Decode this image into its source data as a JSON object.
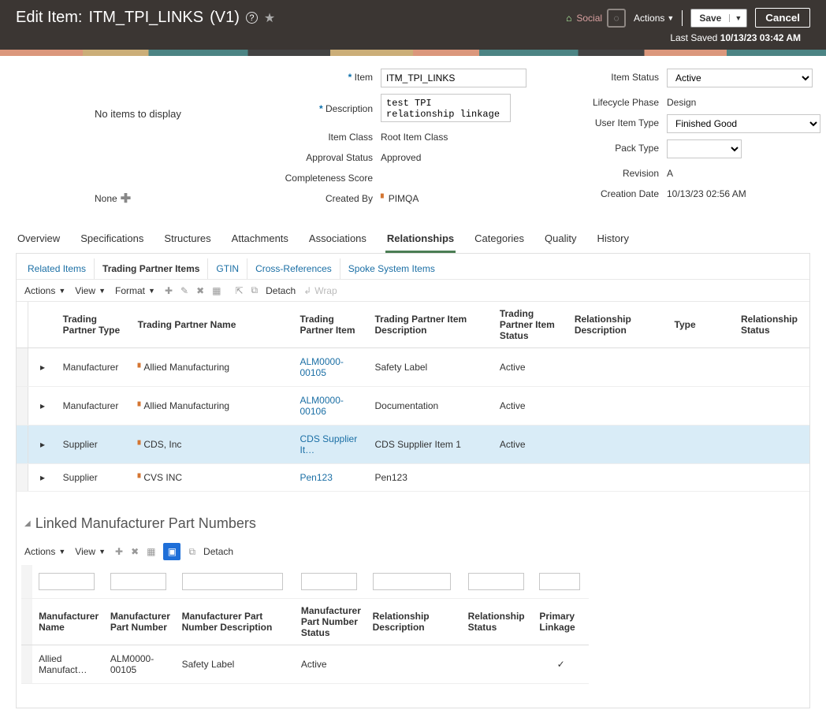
{
  "header": {
    "title_prefix": "Edit Item:",
    "item_code": "ITM_TPI_LINKS",
    "version": "(V1)",
    "social_label": "Social",
    "actions_label": "Actions",
    "save_label": "Save",
    "cancel_label": "Cancel",
    "last_saved_label": "Last Saved",
    "last_saved_value": "10/13/23 03:42 AM"
  },
  "left": {
    "no_items": "No items to display",
    "none": "None"
  },
  "form": {
    "item_label": "Item",
    "item_value": "ITM_TPI_LINKS",
    "description_label": "Description",
    "description_value": "test TPI relationship linkage",
    "item_class_label": "Item Class",
    "item_class_value": "Root Item Class",
    "approval_status_label": "Approval Status",
    "approval_status_value": "Approved",
    "completeness_label": "Completeness Score",
    "completeness_value": "",
    "created_by_label": "Created By",
    "created_by_value": "PIMQA"
  },
  "form2": {
    "item_status_label": "Item Status",
    "item_status_value": "Active",
    "lifecycle_label": "Lifecycle Phase",
    "lifecycle_value": "Design",
    "user_item_type_label": "User Item Type",
    "user_item_type_value": "Finished Good",
    "pack_type_label": "Pack Type",
    "pack_type_value": "",
    "revision_label": "Revision",
    "revision_value": "A",
    "creation_date_label": "Creation Date",
    "creation_date_value": "10/13/23 02:56 AM"
  },
  "tabs": [
    "Overview",
    "Specifications",
    "Structures",
    "Attachments",
    "Associations",
    "Relationships",
    "Categories",
    "Quality",
    "History"
  ],
  "active_tab": "Relationships",
  "subtabs": [
    "Related Items",
    "Trading Partner Items",
    "GTIN",
    "Cross-References",
    "Spoke System Items"
  ],
  "active_subtab": "Trading Partner Items",
  "toolbar": {
    "actions": "Actions",
    "view": "View",
    "format": "Format",
    "detach": "Detach",
    "wrap": "Wrap"
  },
  "tpi_headers": [
    "Trading Partner Type",
    "Trading Partner Name",
    "Trading Partner Item",
    "Trading Partner Item Description",
    "Trading Partner Item Status",
    "Relationship Description",
    "Type",
    "Relationship Status"
  ],
  "tpi_rows": [
    {
      "type": "Manufacturer",
      "name": "Allied Manufacturing",
      "item": "ALM0000-00105",
      "desc": "Safety Label",
      "status": "Active",
      "selected": false
    },
    {
      "type": "Manufacturer",
      "name": "Allied Manufacturing",
      "item": "ALM0000-00106",
      "desc": "Documentation",
      "status": "Active",
      "selected": false
    },
    {
      "type": "Supplier",
      "name": "CDS, Inc",
      "item": "CDS Supplier It…",
      "desc": "CDS Supplier Item 1",
      "status": "Active",
      "selected": true
    },
    {
      "type": "Supplier",
      "name": "CVS INC",
      "item": "Pen123",
      "desc": "Pen123",
      "status": "",
      "selected": false
    }
  ],
  "linked": {
    "title": "Linked Manufacturer Part Numbers",
    "toolbar": {
      "actions": "Actions",
      "view": "View",
      "detach": "Detach"
    },
    "headers": [
      "Manufacturer Name",
      "Manufacturer Part Number",
      "Manufacturer Part Number Description",
      "Manufacturer Part Number Status",
      "Relationship Description",
      "Relationship Status",
      "Primary Linkage"
    ],
    "rows": [
      {
        "name": "Allied Manufact…",
        "part": "ALM0000-00105",
        "desc": "Safety Label",
        "status": "Active",
        "rdesc": "",
        "rstatus": "",
        "primary": true
      }
    ]
  }
}
